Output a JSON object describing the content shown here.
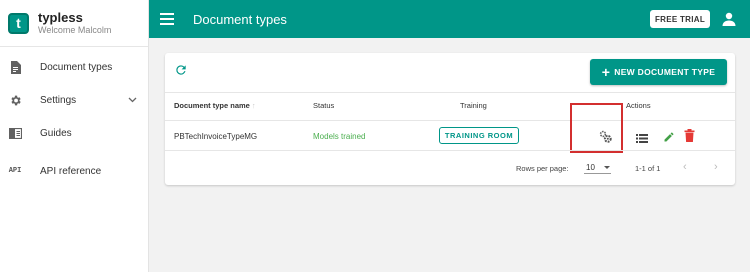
{
  "brand": {
    "name": "typless",
    "subtitle": "Welcome Malcolm",
    "logo_letter": "t"
  },
  "sidebar": {
    "items": [
      {
        "label": "Document types",
        "icon": "document-icon"
      },
      {
        "label": "Settings",
        "icon": "gear-icon",
        "expandable": true
      },
      {
        "label": "Guides",
        "icon": "book-icon"
      },
      {
        "label": "API reference",
        "icon": "api-icon",
        "icon_text": "API"
      }
    ]
  },
  "topbar": {
    "title": "Document types",
    "free_trial_label": "FREE TRIAL"
  },
  "toolbar": {
    "new_button_label": "NEW DOCUMENT TYPE"
  },
  "table": {
    "columns": [
      "Document type name",
      "Status",
      "Training",
      "Actions"
    ],
    "rows": [
      {
        "name": "PBTechInvoiceTypeMG",
        "status": "Models trained",
        "training_label": "TRAINING ROOM"
      }
    ]
  },
  "pagination": {
    "rows_per_page_label": "Rows per page:",
    "rows_per_page_value": "10",
    "range": "1-1 of 1"
  },
  "colors": {
    "primary": "#009688",
    "success": "#4caf50",
    "edit": "#43a047",
    "delete": "#e53935",
    "highlight": "#d32f2f"
  }
}
